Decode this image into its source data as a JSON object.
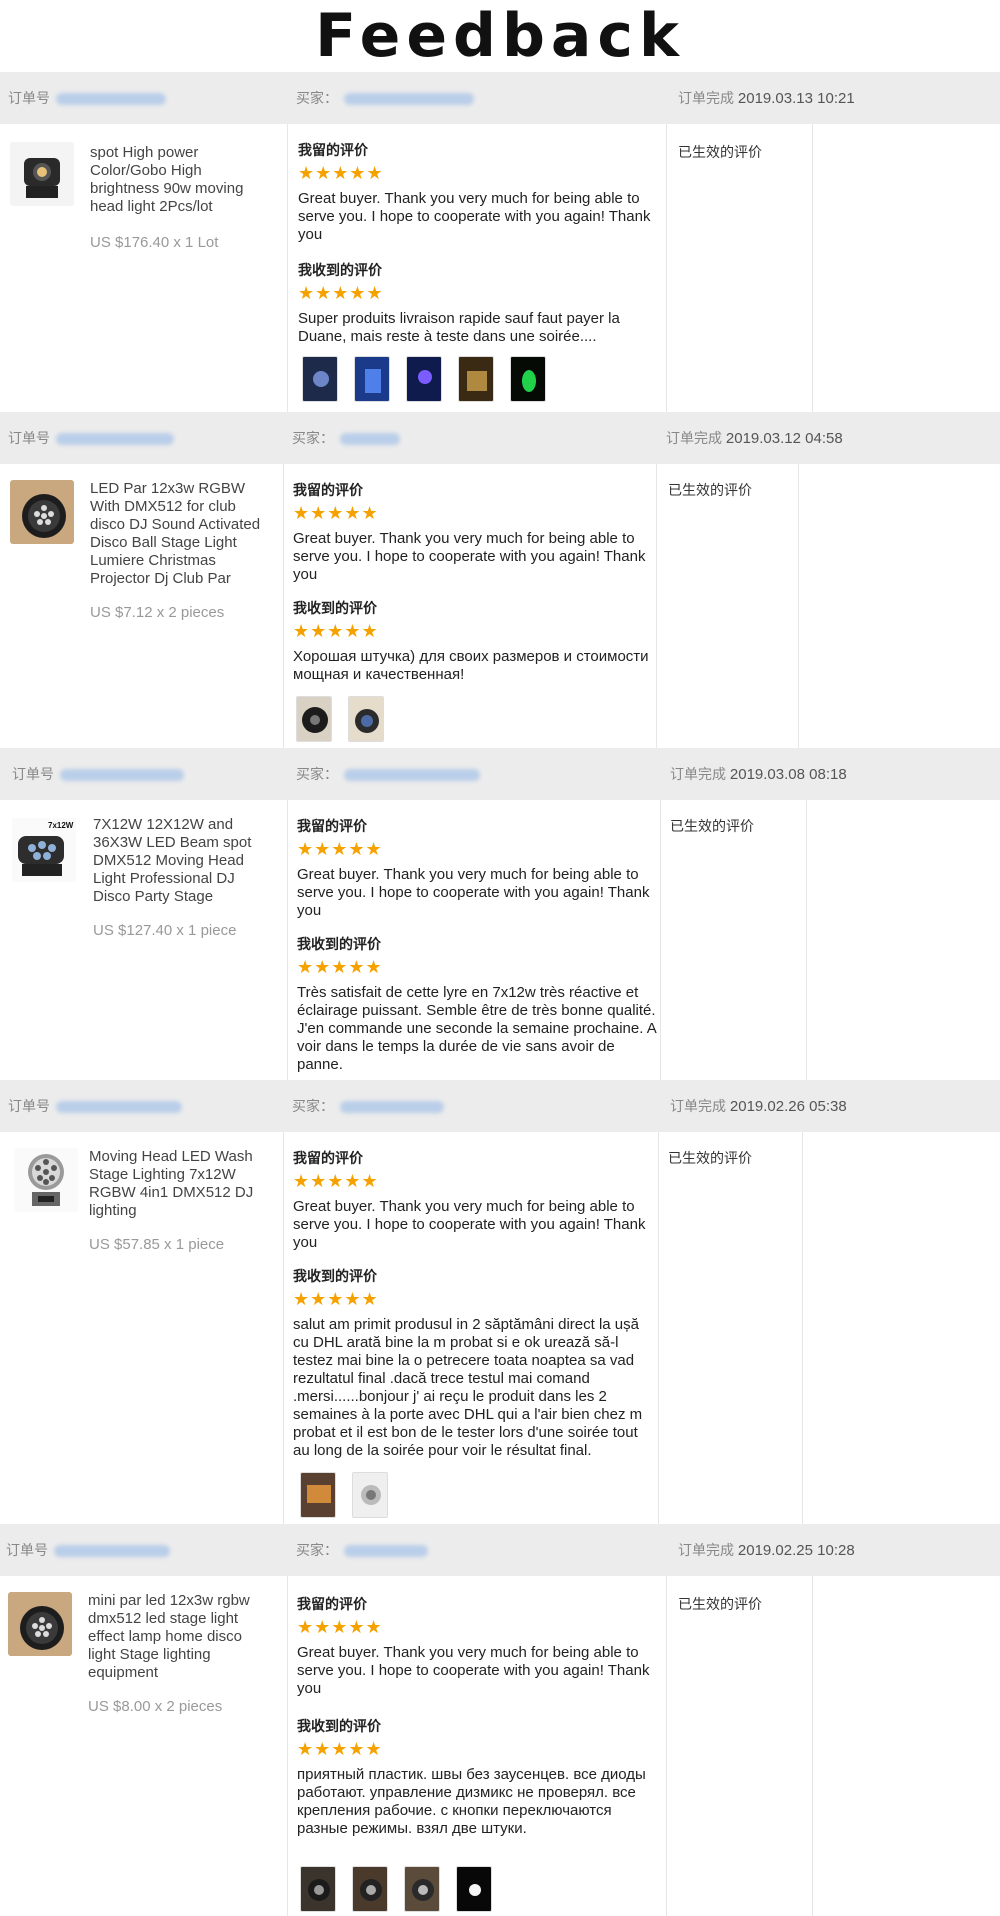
{
  "page": {
    "title": "Feedback"
  },
  "labels": {
    "order_no": "订单号",
    "buyer": "买家：",
    "completed": "订单完成",
    "left_review": "我留的评价",
    "received_review": "我收到的评价",
    "status": "已生效的评价",
    "stars": "★★★★★"
  },
  "orders": [
    {
      "date": "2019.03.13 10:21",
      "product": "spot High power Color/Gobo High brightness 90w moving head light 2Pcs/lot",
      "price": "US $176.40 x 1 Lot",
      "left_text": "Great buyer. Thank you very much for being able to serve you. I hope to cooperate with you again! Thank you",
      "received_text": "Super produits livraison rapide sauf faut payer la Duane, mais reste à teste dans une soirée....",
      "photos": [
        "photo-1",
        "photo-2",
        "photo-3",
        "photo-4",
        "photo-5"
      ]
    },
    {
      "date": "2019.03.12 04:58",
      "product": "LED Par 12x3w RGBW With DMX512 for club disco DJ Sound Activated Disco Ball Stage Light Lumiere Christmas Projector Dj Club Par",
      "price": "US $7.12 x 2 pieces",
      "left_text": "Great buyer. Thank you very much for being able to serve you. I hope to cooperate with you again! Thank you",
      "received_text": "Хорошая штучка) для своих размеров и стоимости мощная и качественная!",
      "photos": [
        "photo-1",
        "photo-2"
      ]
    },
    {
      "date": "2019.03.08 08:18",
      "product": "7X12W 12X12W and 36X3W LED Beam spot DMX512 Moving Head Light Professional DJ Disco Party Stage",
      "price": "US $127.40 x 1 piece",
      "left_text": "Great buyer. Thank you very much for being able to serve you. I hope to cooperate with you again! Thank you",
      "received_text": "Très satisfait de cette lyre en 7x12w très réactive et éclairage puissant. Semble être de très bonne qualité. J'en commande une seconde la semaine prochaine. A voir dans le temps la durée de vie sans avoir de panne.",
      "photos": []
    },
    {
      "date": "2019.02.26 05:38",
      "product": "Moving Head LED Wash Stage Lighting 7x12W RGBW 4in1 DMX512 DJ lighting",
      "price": "US $57.85 x 1 piece",
      "left_text": "Great buyer. Thank you very much for being able to serve you. I hope to cooperate with you again! Thank you",
      "received_text": "salut am primit produsul in 2 săptămâni direct la ușă cu DHL arată bine la m probat si e ok urează să-l testez mai bine la o petrecere toata noaptea sa vad rezultatul final .dacă trece testul mai comand .mersi......bonjour j' ai reçu le produit dans les 2 semaines à la porte avec DHL qui a l'air bien chez m probat et il est bon de le tester lors d'une soirée tout au long de la soirée pour voir le résultat final.",
      "photos": [
        "photo-1",
        "photo-2"
      ]
    },
    {
      "date": "2019.02.25 10:28",
      "product": "mini par led 12x3w rgbw dmx512 led stage light effect lamp home disco light Stage lighting equipment",
      "price": "US $8.00 x 2 pieces",
      "left_text": "Great buyer. Thank you very much for being able to serve you. I hope to cooperate with you again! Thank you",
      "received_text": "приятный пластик. швы без заусенцев. все диоды работают. управление дизмикс не проверял. все крепления рабочие. с кнопки переключаются разные режимы. взял две штуки.",
      "photos": [
        "photo-1",
        "photo-2",
        "photo-3",
        "photo-4"
      ]
    }
  ]
}
